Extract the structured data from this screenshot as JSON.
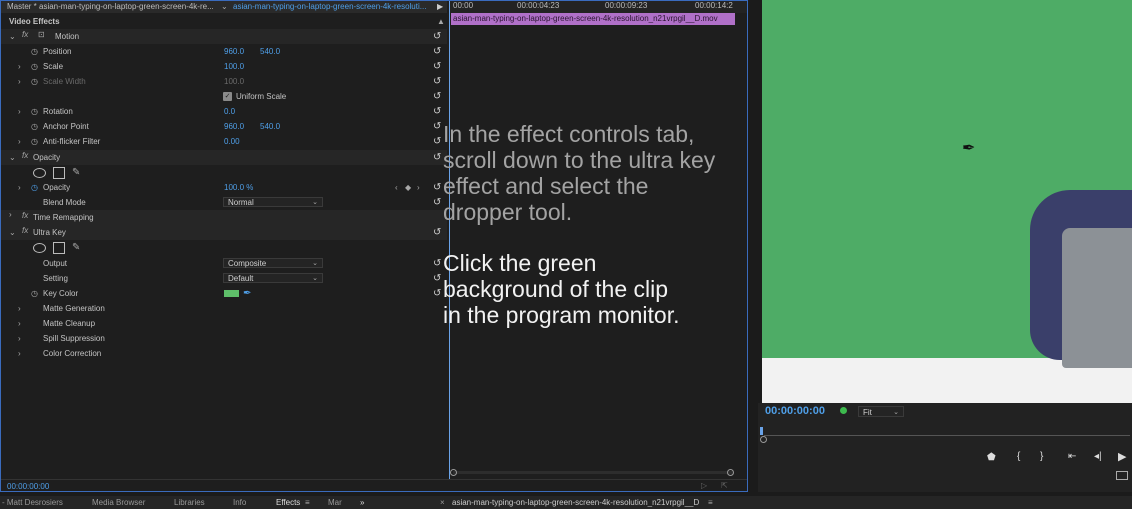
{
  "effect_controls": {
    "master_label": "Master * asian-man-typing-on-laptop-green-screen-4k-re...",
    "clip_label": "asian-man-typing-on-laptop-green-screen-4k-resoluti...",
    "video_effects": "Video Effects",
    "motion": "Motion",
    "position_label": "Position",
    "position_x": "960.0",
    "position_y": "540.0",
    "scale_label": "Scale",
    "scale_value": "100.0",
    "scale_width_label": "Scale Width",
    "scale_width_value": "100.0",
    "uniform_scale": "Uniform Scale",
    "rotation_label": "Rotation",
    "rotation_value": "0.0",
    "anchor_label": "Anchor Point",
    "anchor_x": "960.0",
    "anchor_y": "540.0",
    "antiflicker_label": "Anti-flicker Filter",
    "antiflicker_value": "0.00",
    "opacity_section": "Opacity",
    "opacity_label": "Opacity",
    "opacity_value": "100.0 %",
    "blend_label": "Blend Mode",
    "blend_value": "Normal",
    "time_remap": "Time Remapping",
    "ultra_key": "Ultra Key",
    "output_label": "Output",
    "output_value": "Composite",
    "setting_label": "Setting",
    "setting_value": "Default",
    "key_color_label": "Key Color",
    "key_color_hex": "#5fbf6a",
    "matte_generation": "Matte Generation",
    "matte_cleanup": "Matte Cleanup",
    "spill_suppression": "Spill Suppression",
    "color_correction": "Color Correction",
    "timecode": "00:00:00:00"
  },
  "timeline": {
    "t0": "00:00",
    "t1": "00:00:04:23",
    "t2": "00:00:09:23",
    "t3": "00:00:14:2",
    "clip_name": "asian-man-typing-on-laptop-green-screen-4k-resolution_n21vrpgil__D.mov"
  },
  "overlay": {
    "p1": "In the effect controls tab,\nscroll down to the ultra key\neffect and select the\ndropper tool.",
    "p2": "Click the green\nbackground of the clip\nin the program monitor."
  },
  "program_monitor": {
    "timecode": "00:00:00:00",
    "fit_value": "Fit"
  },
  "bottom_tabs": {
    "matt": "Matt Desrosiers",
    "media_browser": "Media Browser",
    "libraries": "Libraries",
    "info": "Info",
    "effects": "Effects",
    "markers": "Mar",
    "more": "»",
    "sequence": "asian-man-typing-on-laptop-green-screen-4k-resolution_n21vrpgil__D"
  },
  "colors": {
    "accent": "#4f9fe8",
    "green_screen": "#4eac66",
    "clip": "#b070c8"
  }
}
